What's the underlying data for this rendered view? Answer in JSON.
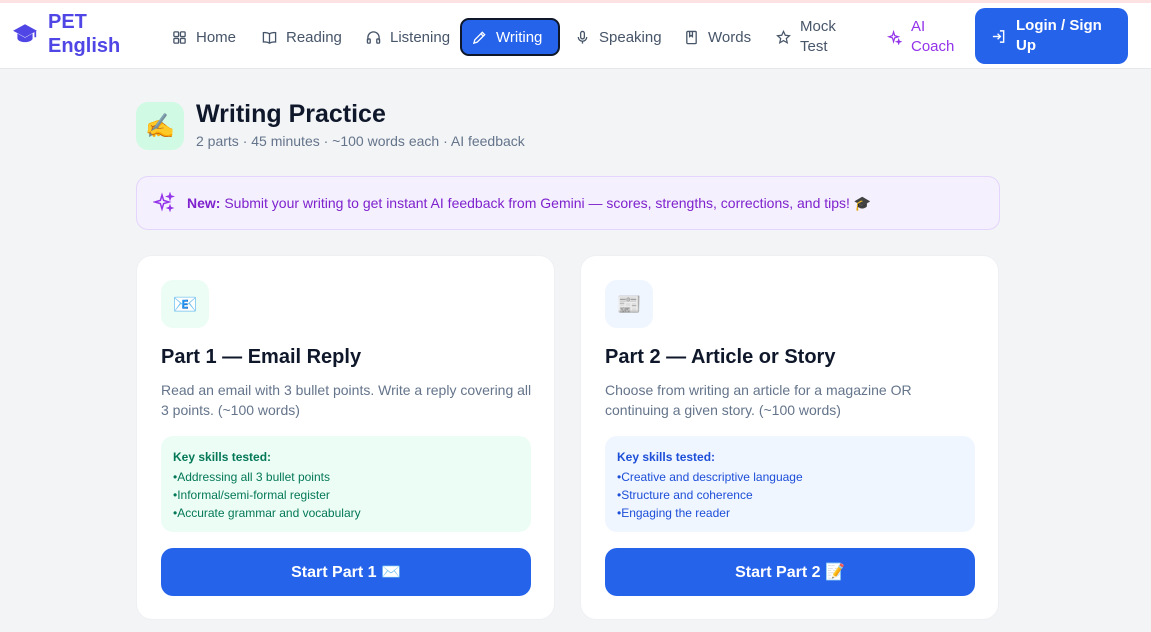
{
  "brand": {
    "name": "PET English"
  },
  "nav": {
    "items": [
      {
        "label": "Home",
        "icon": "grid-icon"
      },
      {
        "label": "Reading",
        "icon": "book-open-icon"
      },
      {
        "label": "Listening",
        "icon": "headphones-icon"
      },
      {
        "label": "Writing",
        "icon": "pencil-icon",
        "active": true
      },
      {
        "label": "Speaking",
        "icon": "microphone-icon"
      },
      {
        "label": "Words",
        "icon": "bookmark-book-icon"
      },
      {
        "label": "Mock Test",
        "icon": "star-icon"
      },
      {
        "label": "AI Coach",
        "icon": "sparkles-icon"
      }
    ],
    "login_label": "Login / Sign Up"
  },
  "header": {
    "emoji": "✍️",
    "title": "Writing Practice",
    "subtitle": "2 parts · 45 minutes · ~100 words each · AI feedback"
  },
  "banner": {
    "strong": "New:",
    "text": "Submit your writing to get instant AI feedback from Gemini — scores, strengths, corrections, and tips! 🎓"
  },
  "cards": [
    {
      "emoji": "📧",
      "title": "Part 1 — Email Reply",
      "description": "Read an email with 3 bullet points. Write a reply covering all 3 points. (~100 words)",
      "skills_title": "Key skills tested:",
      "skills": [
        "Addressing all 3 bullet points",
        "Informal/semi-formal register",
        "Accurate grammar and vocabulary"
      ],
      "button": "Start Part 1 ✉️"
    },
    {
      "emoji": "📰",
      "title": "Part 2 — Article or Story",
      "description": "Choose from writing an article for a magazine OR continuing a given story. (~100 words)",
      "skills_title": "Key skills tested:",
      "skills": [
        "Creative and descriptive language",
        "Structure and coherence",
        "Engaging the reader"
      ],
      "button": "Start Part 2 📝"
    }
  ],
  "colors": {
    "brand": "#4f46e5",
    "primary": "#2563eb",
    "ai_purple": "#9333ea",
    "green_bg": "#ecfdf5",
    "green_text": "#047857",
    "blue_bg": "#eff6ff",
    "blue_text": "#1d4ed8"
  }
}
